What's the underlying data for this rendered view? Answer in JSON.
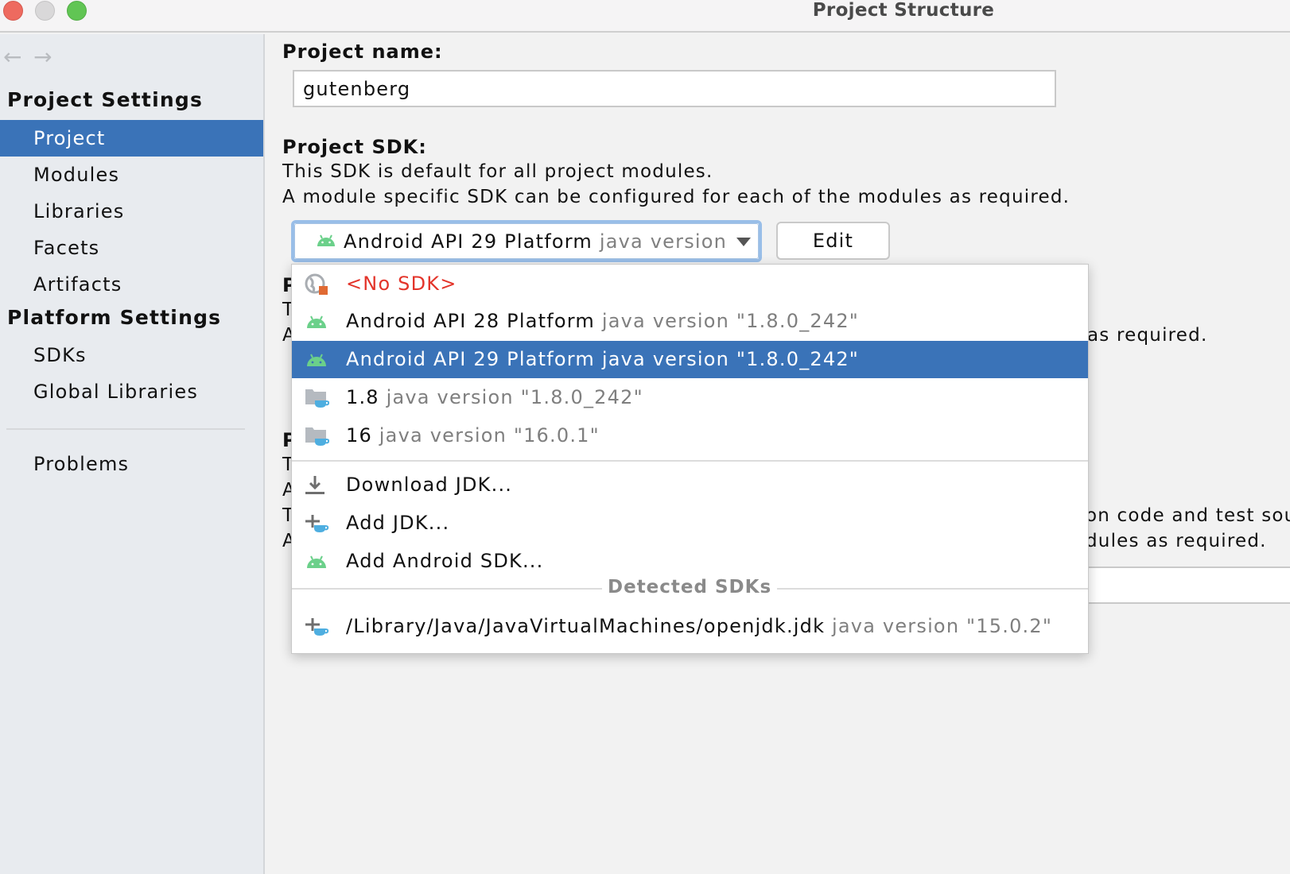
{
  "window": {
    "title": "Project Structure",
    "traffic_lights": [
      "close",
      "minimize",
      "maximize"
    ]
  },
  "sidebar": {
    "back_icon": "←",
    "forward_icon": "→",
    "project_settings_header": "Project Settings",
    "platform_settings_header": "Platform Settings",
    "project_items": [
      {
        "label": "Project",
        "selected": true
      },
      {
        "label": "Modules"
      },
      {
        "label": "Libraries"
      },
      {
        "label": "Facets"
      },
      {
        "label": "Artifacts"
      }
    ],
    "platform_items": [
      {
        "label": "SDKs"
      },
      {
        "label": "Global Libraries"
      }
    ],
    "problems_label": "Problems"
  },
  "main": {
    "project_name_label": "Project name:",
    "project_name_value": "gutenberg",
    "project_sdk_label": "Project SDK:",
    "sdk_desc_line1": "This SDK is default for all project modules.",
    "sdk_desc_line2": "A module specific SDK can be configured for each of the modules as required.",
    "sdk_combo": {
      "name": "Android API 29 Platform",
      "detail": "java version"
    },
    "edit_button": "Edit",
    "obscured": {
      "section2_label_initial": "P",
      "section2_line1_initial": "T",
      "section2_line2_initial": "A",
      "section2_line2_tail": "as required.",
      "section3_label_initial": "P",
      "section3_line1_initial": "T",
      "section3_line2_initial": "A",
      "section3_line3_initial": "T",
      "section3_line3_tail": "on code and test sou",
      "section3_line4_initial": "A",
      "section3_line4_tail": "dules as required."
    }
  },
  "popup": {
    "items": [
      {
        "name": "<No SDK>",
        "detail": "",
        "icon": "no-sdk-globe-icon",
        "type": "nosdk"
      },
      {
        "name": "Android API 28 Platform",
        "detail": "java version \"1.8.0_242\"",
        "icon": "android-icon"
      },
      {
        "name": "Android API 29 Platform",
        "detail": "java version \"1.8.0_242\"",
        "icon": "android-icon",
        "selected": true
      },
      {
        "name": "1.8",
        "detail": "java version \"1.8.0_242\"",
        "icon": "jdk-folder-icon"
      },
      {
        "name": "16",
        "detail": "java version \"16.0.1\"",
        "icon": "jdk-folder-icon"
      }
    ],
    "actions": [
      {
        "label": "Download JDK...",
        "icon": "download-icon"
      },
      {
        "label": "Add JDK...",
        "icon": "add-jdk-icon"
      },
      {
        "label": "Add Android SDK...",
        "icon": "android-icon"
      }
    ],
    "detected_header": "Detected SDKs",
    "detected": [
      {
        "name": "/Library/Java/JavaVirtualMachines/openjdk.jdk",
        "detail": "java version \"15.0.2\"",
        "icon": "add-jdk-icon"
      }
    ]
  },
  "colors": {
    "selection": "#3a73b8",
    "error_red": "#e3342a",
    "android_green": "#6bd08a",
    "focus_ring": "#99bee8"
  }
}
